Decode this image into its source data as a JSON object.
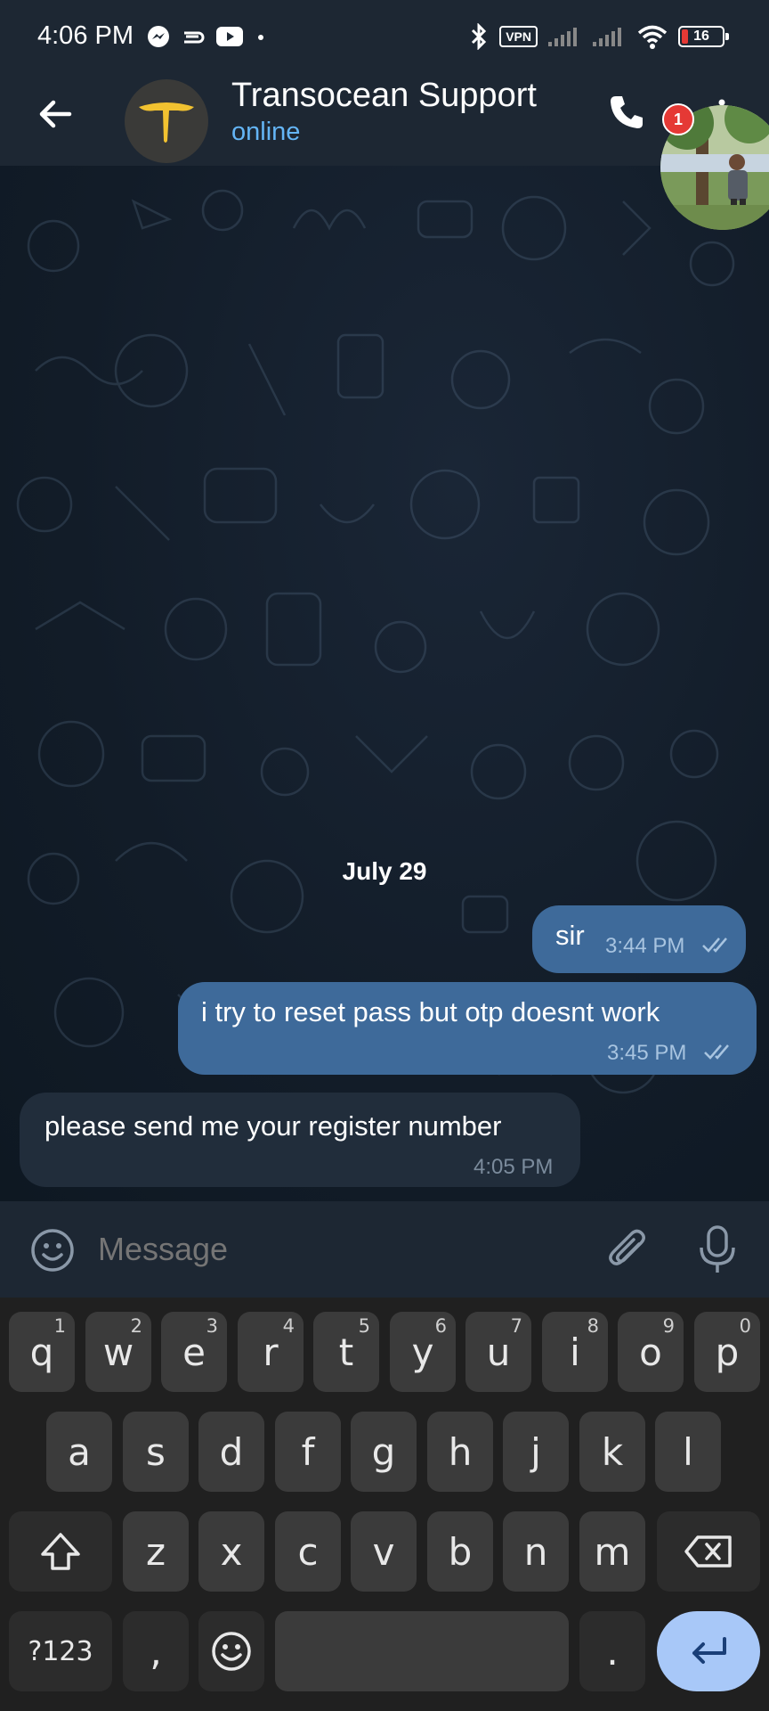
{
  "status_bar": {
    "time": "4:06 PM",
    "vpn_label": "VPN",
    "battery": "16"
  },
  "header": {
    "title": "Transocean Support",
    "status": "online",
    "notification_count": "1"
  },
  "chat": {
    "date_separator": "July 29",
    "messages": [
      {
        "direction": "out",
        "text": "sir",
        "time": "3:44 PM",
        "read": true
      },
      {
        "direction": "out",
        "text": "i try to reset pass but otp doesnt work",
        "time": "3:45 PM",
        "read": true
      },
      {
        "direction": "in",
        "text": "please send me your register number",
        "time": "4:05 PM"
      }
    ]
  },
  "input": {
    "placeholder": "Message"
  },
  "keyboard": {
    "row1": [
      {
        "key": "q",
        "hint": "1"
      },
      {
        "key": "w",
        "hint": "2"
      },
      {
        "key": "e",
        "hint": "3"
      },
      {
        "key": "r",
        "hint": "4"
      },
      {
        "key": "t",
        "hint": "5"
      },
      {
        "key": "y",
        "hint": "6"
      },
      {
        "key": "u",
        "hint": "7"
      },
      {
        "key": "i",
        "hint": "8"
      },
      {
        "key": "o",
        "hint": "9"
      },
      {
        "key": "p",
        "hint": "0"
      }
    ],
    "row2": [
      "a",
      "s",
      "d",
      "f",
      "g",
      "h",
      "j",
      "k",
      "l"
    ],
    "row3": [
      "z",
      "x",
      "c",
      "v",
      "b",
      "n",
      "m"
    ],
    "symbols_label": "?123",
    "comma": ",",
    "period": "."
  },
  "colors": {
    "header_bg": "#1d2733",
    "outgoing_bubble": "#3e6a9a",
    "incoming_bubble": "#212d3b",
    "online_status": "#64b5f6",
    "enter_key": "#a8c8f8",
    "badge": "#e53935"
  },
  "icons": {
    "status_left": [
      "messenger-icon",
      "cloud-sync-icon",
      "youtube-icon",
      "dot-icon"
    ],
    "status_right": [
      "bluetooth-icon",
      "vpn-icon",
      "signal-icon",
      "signal-icon",
      "wifi-icon",
      "battery-icon"
    ],
    "header": [
      "back-arrow-icon",
      "phone-icon",
      "more-vert-icon"
    ],
    "input": [
      "emoji-icon",
      "paperclip-icon",
      "mic-icon"
    ]
  }
}
